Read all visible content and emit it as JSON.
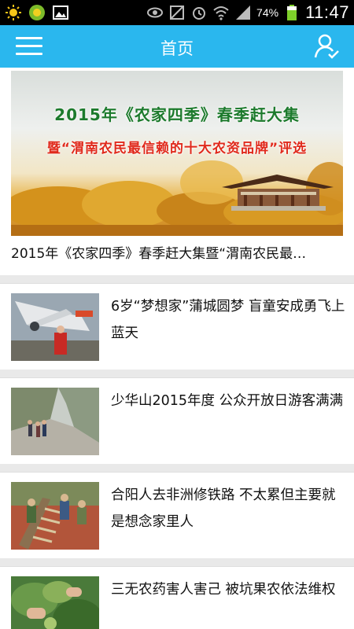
{
  "status_bar": {
    "battery": "74%",
    "time": "11:47"
  },
  "header": {
    "title": "首页"
  },
  "featured": {
    "banner_line1": "2015年《农家四季》春季赶大集",
    "banner_line2": "暨“渭南农民最信赖的十大农资品牌”评选",
    "title": "2015年《农家四季》春季赶大集暨“渭南农民最…"
  },
  "news": [
    {
      "title": "6岁“梦想家”蒲城圆梦 盲童安成勇飞上蓝天"
    },
    {
      "title": "少华山2015年度 公众开放日游客满满"
    },
    {
      "title": "合阳人去非洲修铁路 不太累但主要就是想念家里人"
    },
    {
      "title": "三无农药害人害己 被坑果农依法维权"
    }
  ],
  "colors": {
    "header_bg": "#2ab7ee",
    "page_bg": "#e9e9e9",
    "banner_green": "#1c7a2c",
    "banner_red": "#e02a1c"
  },
  "icons": {
    "menu": "hamburger-menu-icon",
    "user": "user-check-icon"
  }
}
